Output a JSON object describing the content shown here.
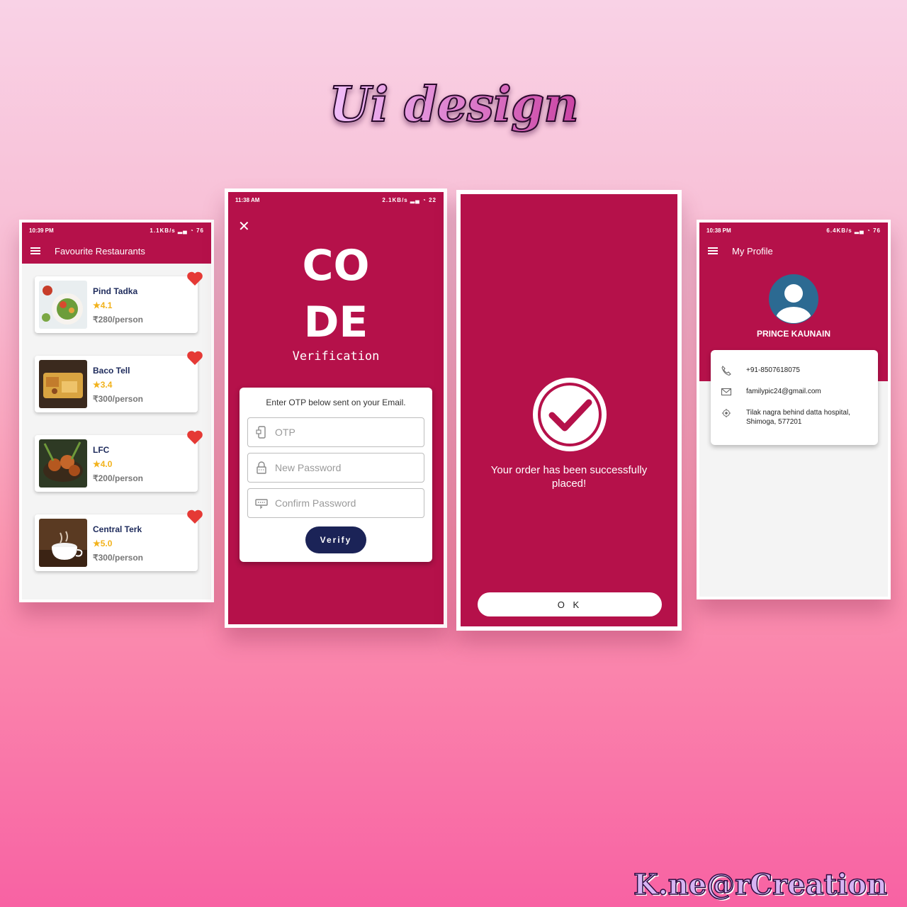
{
  "title": "Ui design",
  "watermark": "K.ne@rCreation",
  "colors": {
    "primary": "#b5114a",
    "accent_dark": "#1b2357",
    "star": "#f2b21b",
    "heart": "#e53935"
  },
  "restaurants_screen": {
    "status_time": "10:39 PM",
    "status_speed": "1.1KB/s",
    "battery": "76",
    "app_title": "Favourite Restaurants",
    "items": [
      {
        "name": "Pind Tadka",
        "rating": "★4.1",
        "price": "₹280/person",
        "icon": "heart-icon"
      },
      {
        "name": "Baco Tell",
        "rating": "★3.4",
        "price": "₹300/person",
        "icon": "heart-icon"
      },
      {
        "name": "LFC",
        "rating": "★4.0",
        "price": "₹200/person",
        "icon": "heart-icon"
      },
      {
        "name": "Central Terk",
        "rating": "★5.0",
        "price": "₹300/person",
        "icon": "heart-icon"
      }
    ]
  },
  "verify_screen": {
    "status_time": "11:38 AM",
    "status_speed": "2.1KB/s",
    "battery": "22",
    "code_line1": "CO",
    "code_line2": "DE",
    "subtitle": "Verification",
    "instruction": "Enter OTP below sent on your Email.",
    "otp_placeholder": "OTP",
    "new_password_placeholder": "New Password",
    "confirm_password_placeholder": "Confirm Password",
    "verify_label": "Verify"
  },
  "success_screen": {
    "message": "Your order has been successfully placed!",
    "ok_label": "O K"
  },
  "profile_screen": {
    "status_time": "10:38 PM",
    "status_speed": "6.4KB/s",
    "battery": "76",
    "app_title": "My Profile",
    "name": "PRINCE KAUNAIN",
    "phone": "+91-8507618075",
    "email": "familypic24@gmail.com",
    "address": "Tilak nagra behind datta hospital, Shimoga, 577201"
  }
}
